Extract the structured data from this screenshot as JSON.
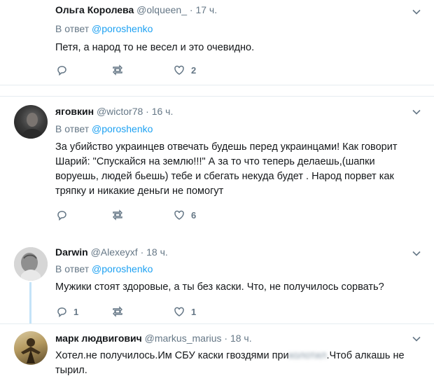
{
  "reply_prefix": "В ответ",
  "tweets": [
    {
      "name": "Ольга Королева",
      "handle": "@olqueen_",
      "time": "· 17 ч.",
      "reply_to": "@poroshenko",
      "text": "Петя, а народ то не весел и это очевидно.",
      "replies": "",
      "retweets": "",
      "likes": "2"
    },
    {
      "name": "яговкин",
      "handle": "@wictor78",
      "time": "· 16 ч.",
      "reply_to": "@poroshenko",
      "text": "За убийство украинцев отвечать будешь перед украинцами! Как говорит Шарий: \"Спускайся на землю!!!\" А за то что теперь делаешь,(шапки воруешь, людей бьешь) тебе и сбегать некуда будет . Народ порвет как тряпку и никакие деньги не помогут",
      "replies": "",
      "retweets": "",
      "likes": "6"
    },
    {
      "name": "Darwin",
      "handle": "@Alexeyxf",
      "time": "· 18 ч.",
      "reply_to": "@poroshenko",
      "text": "Мужики стоят здоровые, а ты без каски. Что, не получилось сорвать?",
      "replies": "1",
      "retweets": "",
      "likes": "1"
    },
    {
      "name": "марк людвигович",
      "handle": "@markus_marius",
      "time": "· 18 ч.",
      "text_before": "Хотел.не получилось.Им СБУ каски гвоздями при",
      "text_blurred": "колотил",
      "text_after": ".Чтоб алкашь не тырил."
    }
  ]
}
